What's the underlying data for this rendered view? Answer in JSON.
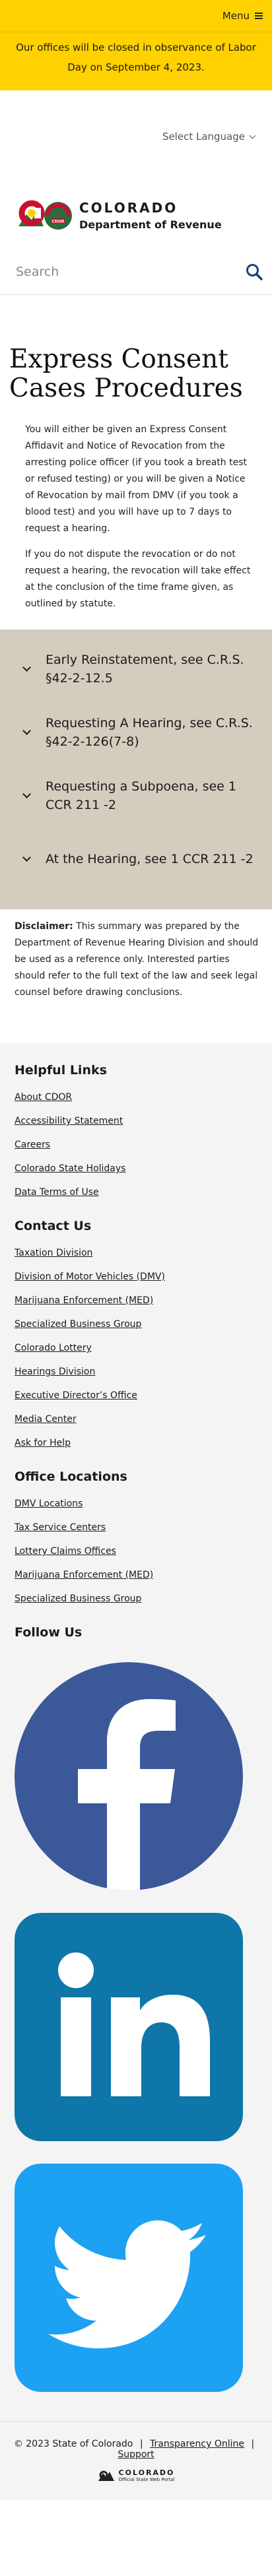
{
  "topbar": {
    "menu_label": "Menu"
  },
  "alert": {
    "text": "Our offices will be closed in observance of Labor Day on September 4, 2023."
  },
  "language": {
    "label": "Select Language"
  },
  "logo": {
    "state": "COLORADO",
    "department": "Department of Revenue",
    "badge": "CDOR"
  },
  "search": {
    "placeholder": "Search"
  },
  "page": {
    "title": "Express Consent Cases Procedures",
    "intro": "You will either be given an Express Consent Affidavit and Notice of Revocation from the arresting police officer (if you took a breath test or refused testing) or you will be given a Notice of Revocation by mail from DMV (if you took a blood test) and you will have up to 7 days to request a hearing.",
    "note": "If you do not dispute the revocation or do not request a hearing, the revocation will take effect at the conclusion of the time frame given, as outlined by statute."
  },
  "accordion": [
    {
      "label": "Early Reinstatement, see C.R.S. §42-2-12.5"
    },
    {
      "label": "Requesting A Hearing, see C.R.S. §42-2-126(7-8)"
    },
    {
      "label": "Requesting a Subpoena, see 1 CCR 211 -2"
    },
    {
      "label": "At the Hearing, see 1 CCR 211 -2"
    }
  ],
  "disclaimer": {
    "label": "Disclaimer:",
    "text": " This summary was prepared by the Department of Revenue Hearing Division and should be used as a reference only. Interested parties should refer to the full text of the law and seek legal counsel before drawing conclusions."
  },
  "footer": {
    "helpful_links": {
      "heading": "Helpful Links",
      "items": [
        "About CDOR",
        "Accessibility Statement",
        "Careers",
        "Colorado State Holidays",
        "Data Terms of Use"
      ]
    },
    "contact_us": {
      "heading": "Contact Us",
      "items": [
        "Taxation Division",
        "Division of Motor Vehicles (DMV)",
        "Marijuana Enforcement (MED)",
        "Specialized Business Group",
        "Colorado Lottery",
        "Hearings Division",
        "Executive Director’s Office",
        "Media Center",
        "Ask for Help"
      ]
    },
    "office_locations": {
      "heading": "Office Locations",
      "items": [
        "DMV Locations",
        "Tax Service Centers",
        "Lottery Claims Offices",
        "Marijuana Enforcement (MED)",
        "Specialized Business Group"
      ]
    },
    "follow_us": {
      "heading": "Follow Us",
      "networks": [
        {
          "icon": "facebook-icon",
          "color": "#3b5998"
        },
        {
          "icon": "linkedin-icon",
          "color": "#0e76a8"
        },
        {
          "icon": "twitter-icon",
          "color": "#1da1f2"
        }
      ]
    }
  },
  "bottom": {
    "copyright": "© 2023 State of Colorado",
    "transparency": "Transparency Online",
    "support": "Support",
    "portal_name": "COLORADO",
    "portal_sub": "Official State Web Portal"
  },
  "colors": {
    "alert_bg": "#ffd100",
    "accordion_bg": "#d4cdbd",
    "footer_bg": "#f4f4f4",
    "search_icon": "#1d3f79"
  }
}
